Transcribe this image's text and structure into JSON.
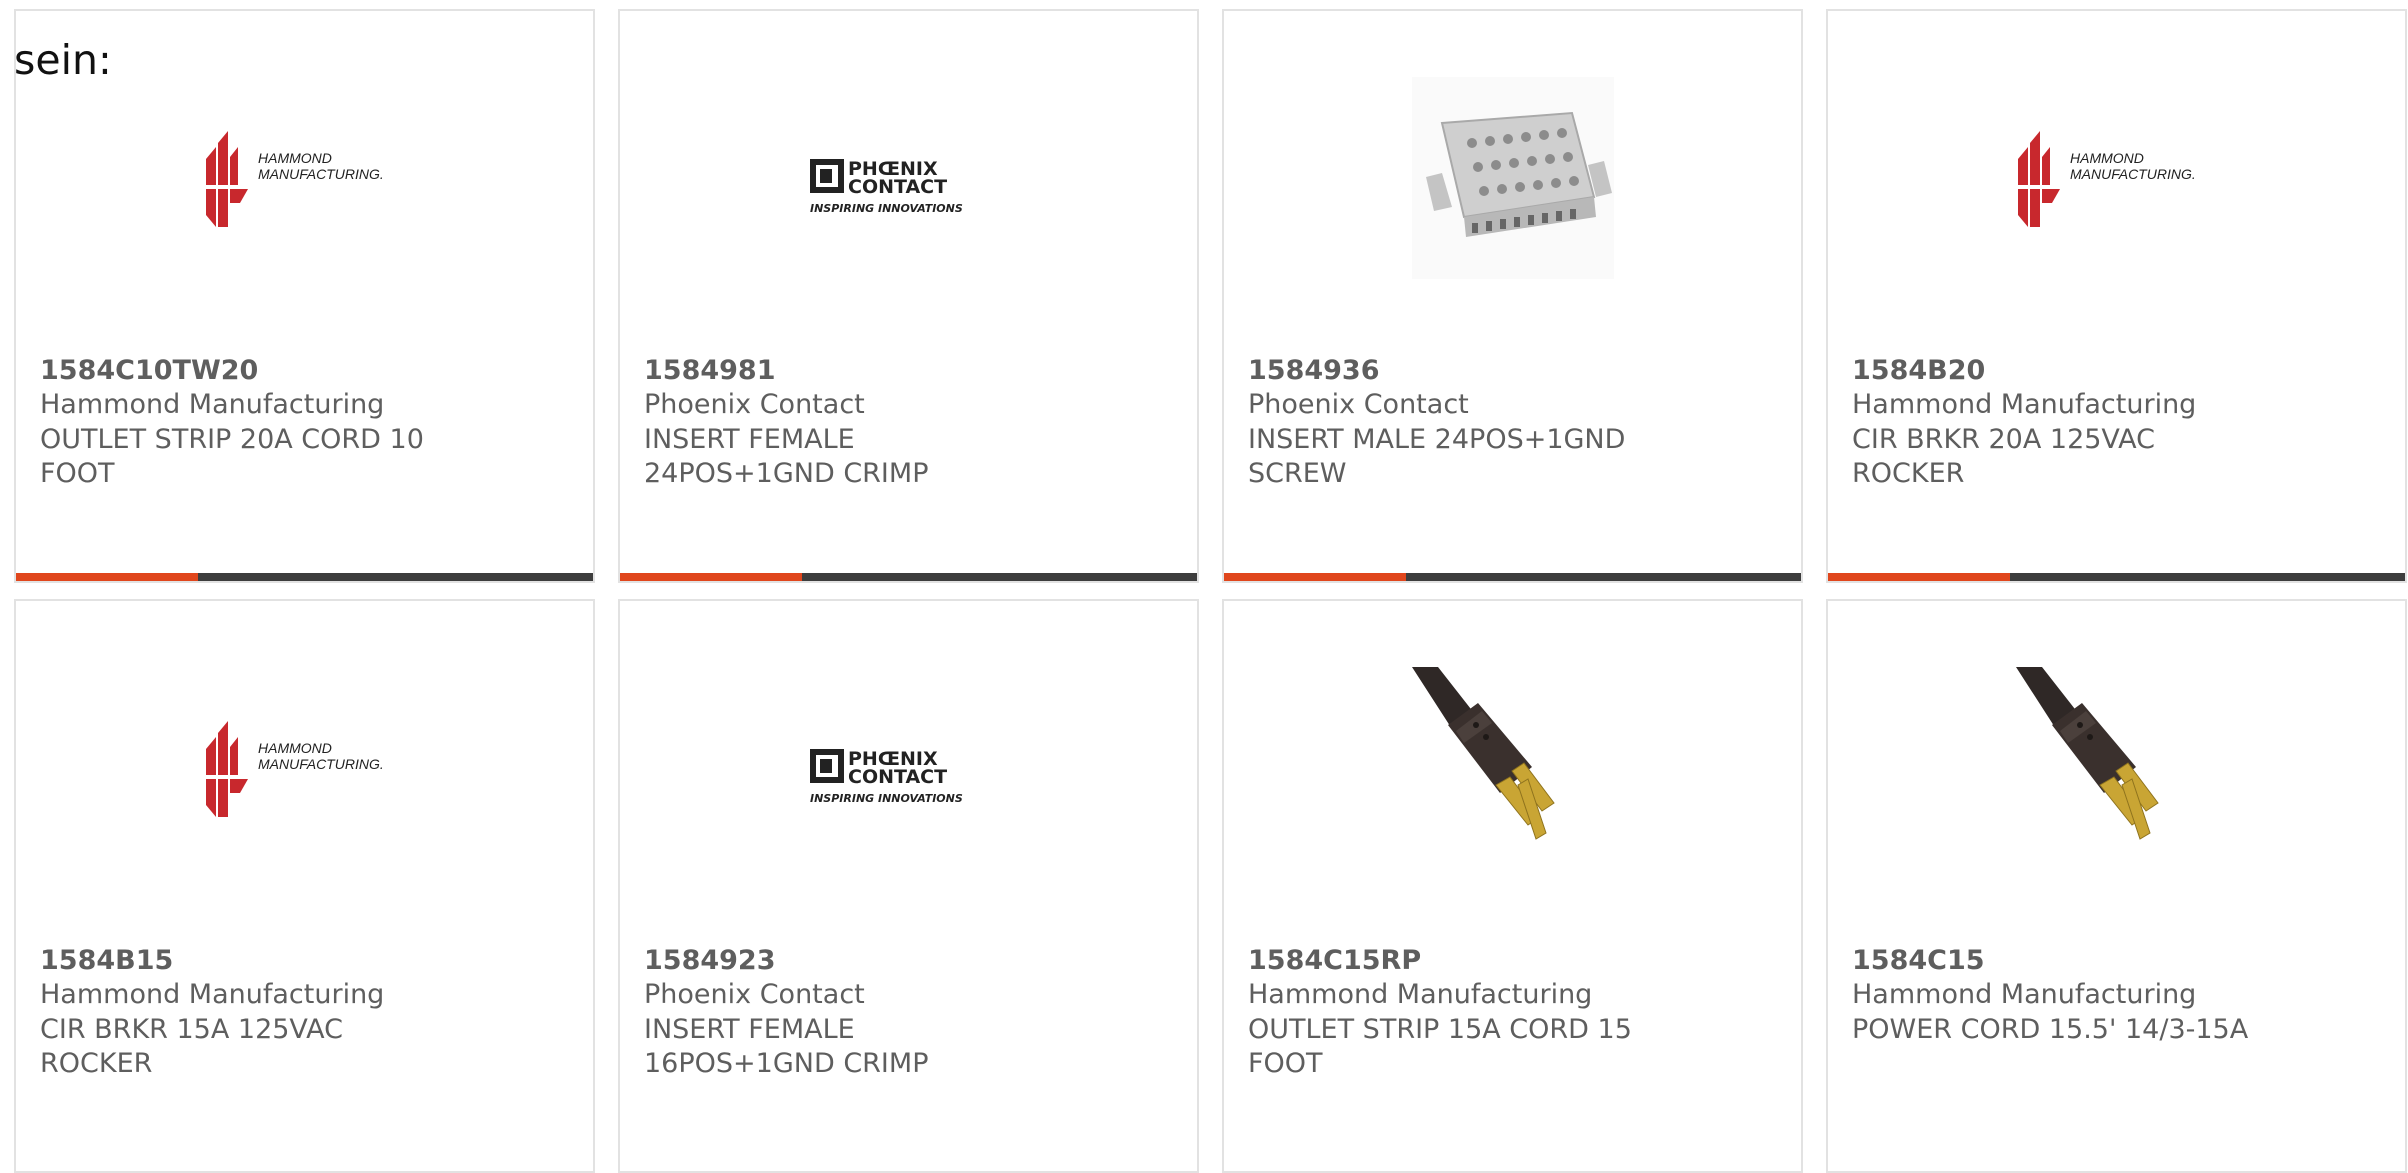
{
  "lead_text": "sein:",
  "colors": {
    "accent": "#e0461c",
    "bar": "#3d3d3d",
    "text": "#5e5e5e",
    "hammond_red": "#c8282d"
  },
  "cards": [
    {
      "part_number": "1584C10TW20",
      "manufacturer": "Hammond Manufacturing",
      "description": "OUTLET STRIP 20A CORD 10 FOOT",
      "image": "hammond-logo",
      "logo_line1": "HAMMOND",
      "logo_line2": "MANUFACTURING."
    },
    {
      "part_number": "1584981",
      "manufacturer": "Phoenix Contact",
      "description": "INSERT FEMALE 24POS+1GND CRIMP",
      "image": "phoenix-contact-logo",
      "logo_line1": "PHŒNIX",
      "logo_line2": "CONTACT",
      "logo_tagline": "INSPIRING INNOVATIONS"
    },
    {
      "part_number": "1584936",
      "manufacturer": "Phoenix Contact",
      "description": "INSERT MALE 24POS+1GND SCREW",
      "image": "connector-insert-photo"
    },
    {
      "part_number": "1584B20",
      "manufacturer": "Hammond Manufacturing",
      "description": "CIR BRKR 20A 125VAC ROCKER",
      "image": "hammond-logo",
      "logo_line1": "HAMMOND",
      "logo_line2": "MANUFACTURING."
    },
    {
      "part_number": "1584B15",
      "manufacturer": "Hammond Manufacturing",
      "description": "CIR BRKR 15A 125VAC ROCKER",
      "image": "hammond-logo",
      "logo_line1": "HAMMOND",
      "logo_line2": "MANUFACTURING."
    },
    {
      "part_number": "1584923",
      "manufacturer": "Phoenix Contact",
      "description": "INSERT FEMALE 16POS+1GND CRIMP",
      "image": "phoenix-contact-logo",
      "logo_line1": "PHŒNIX",
      "logo_line2": "CONTACT",
      "logo_tagline": "INSPIRING INNOVATIONS"
    },
    {
      "part_number": "1584C15RP",
      "manufacturer": "Hammond Manufacturing",
      "description": "OUTLET STRIP 15A CORD 15 FOOT",
      "image": "power-plug-photo"
    },
    {
      "part_number": "1584C15",
      "manufacturer": "Hammond Manufacturing",
      "description": "POWER CORD 15.5' 14/3-15A",
      "image": "power-plug-photo"
    }
  ]
}
